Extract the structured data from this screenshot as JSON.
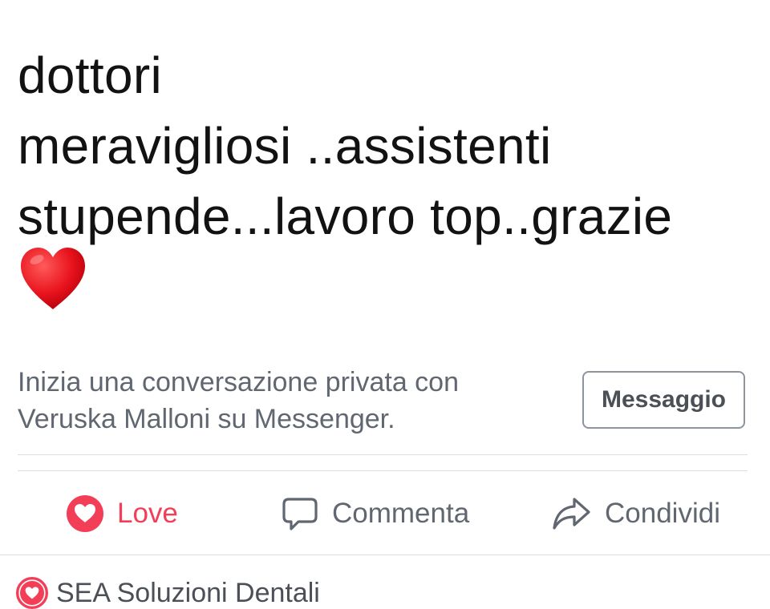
{
  "post": {
    "text_lines": [
      "dottori",
      "meravigliosi ..assistenti",
      "stupende...lavoro top..grazie"
    ],
    "emoji": "red-heart"
  },
  "messenger_prompt": {
    "lines": [
      "Inizia una conversazione privata con",
      "Veruska Malloni su Messenger."
    ],
    "button_label": "Messaggio"
  },
  "actions": {
    "love": {
      "label": "Love",
      "icon": "love-reaction-icon",
      "color": "#f33e58"
    },
    "comment": {
      "label": "Commenta",
      "icon": "comment-icon"
    },
    "share": {
      "label": "Condividi",
      "icon": "share-icon"
    }
  },
  "footer": {
    "reaction_icon": "love-reaction-icon",
    "page_name": "SEA Soluzioni Dentali"
  }
}
